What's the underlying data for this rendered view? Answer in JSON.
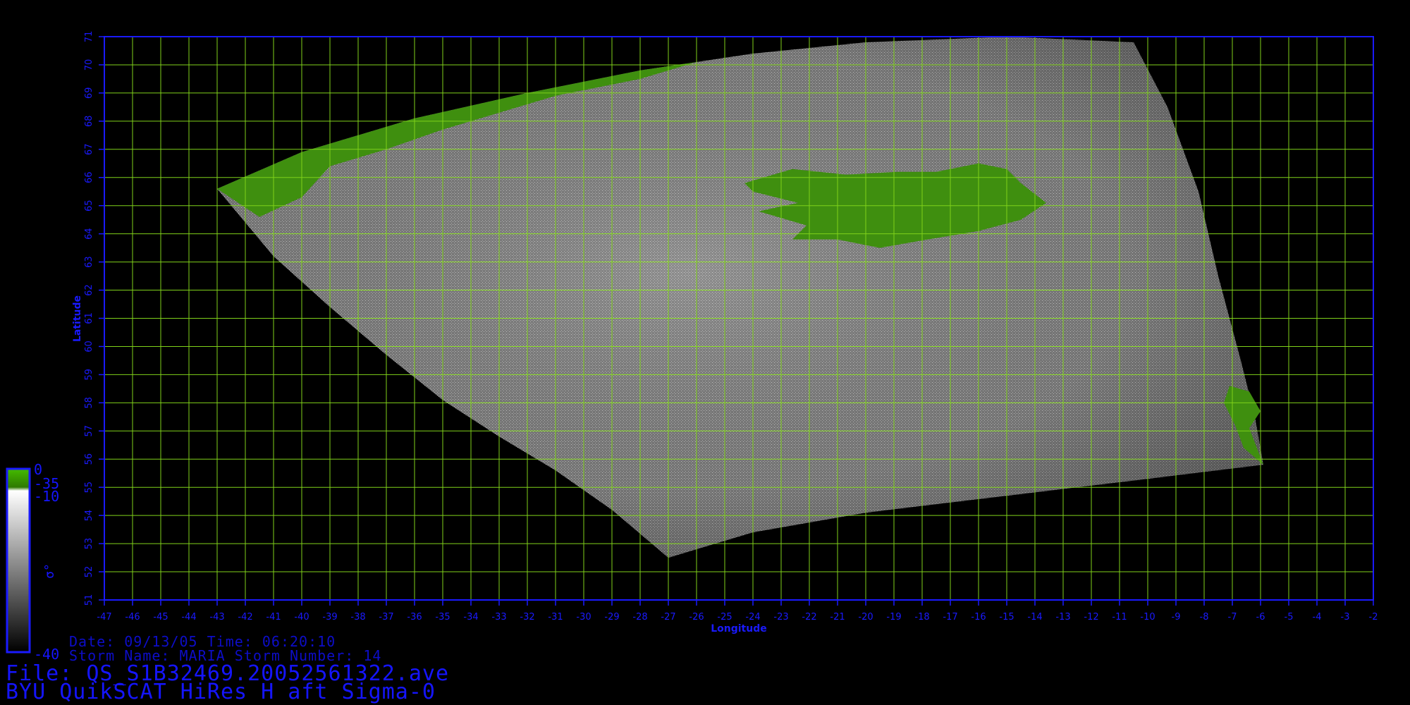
{
  "map": {
    "lon_ticks": [
      -47,
      -46,
      -45,
      -44,
      -43,
      -42,
      -41,
      -40,
      -39,
      -38,
      -37,
      -36,
      -35,
      -34,
      -33,
      -32,
      -31,
      -30,
      -29,
      -28,
      -27,
      -26,
      -25,
      -24,
      -23,
      -22,
      -21,
      -20,
      -19,
      -18,
      -17,
      -16,
      -15,
      -14,
      -13,
      -12,
      -11,
      -10,
      -9,
      -8,
      -7,
      -6,
      -5,
      -4,
      -3,
      -2
    ],
    "lat_ticks": [
      51,
      52,
      53,
      54,
      55,
      56,
      57,
      58,
      59,
      60,
      61,
      62,
      63,
      64,
      65,
      66,
      67,
      68,
      69,
      70,
      71
    ],
    "lon_range": [
      -47,
      -2
    ],
    "lat_range": [
      51,
      71
    ],
    "xlabel": "Longitude",
    "ylabel": "Latitude",
    "grid": true,
    "colors": {
      "background": "#000000",
      "axis": "#1a1aff",
      "grid": "#7fd11a",
      "land": "#3f8f0f",
      "ocean_light": "#b8b8b8",
      "ocean_dark": "#4a4a4a"
    }
  },
  "colorbar": {
    "labels": [
      "0",
      "-35",
      "-10",
      "-40"
    ],
    "symbol": "σ°",
    "colors": [
      "#3aa800",
      "#ffffff",
      "#000000"
    ]
  },
  "info": {
    "date_line": "Date: 09/13/05   Time: 06:20:10",
    "storm_line": "Storm  Name: MARIA   Storm  Number: 14",
    "file_line": "File: QS_S1B32469.20052561322.ave",
    "title_line": "BYU QuikSCAT HiRes H aft Sigma-0"
  }
}
